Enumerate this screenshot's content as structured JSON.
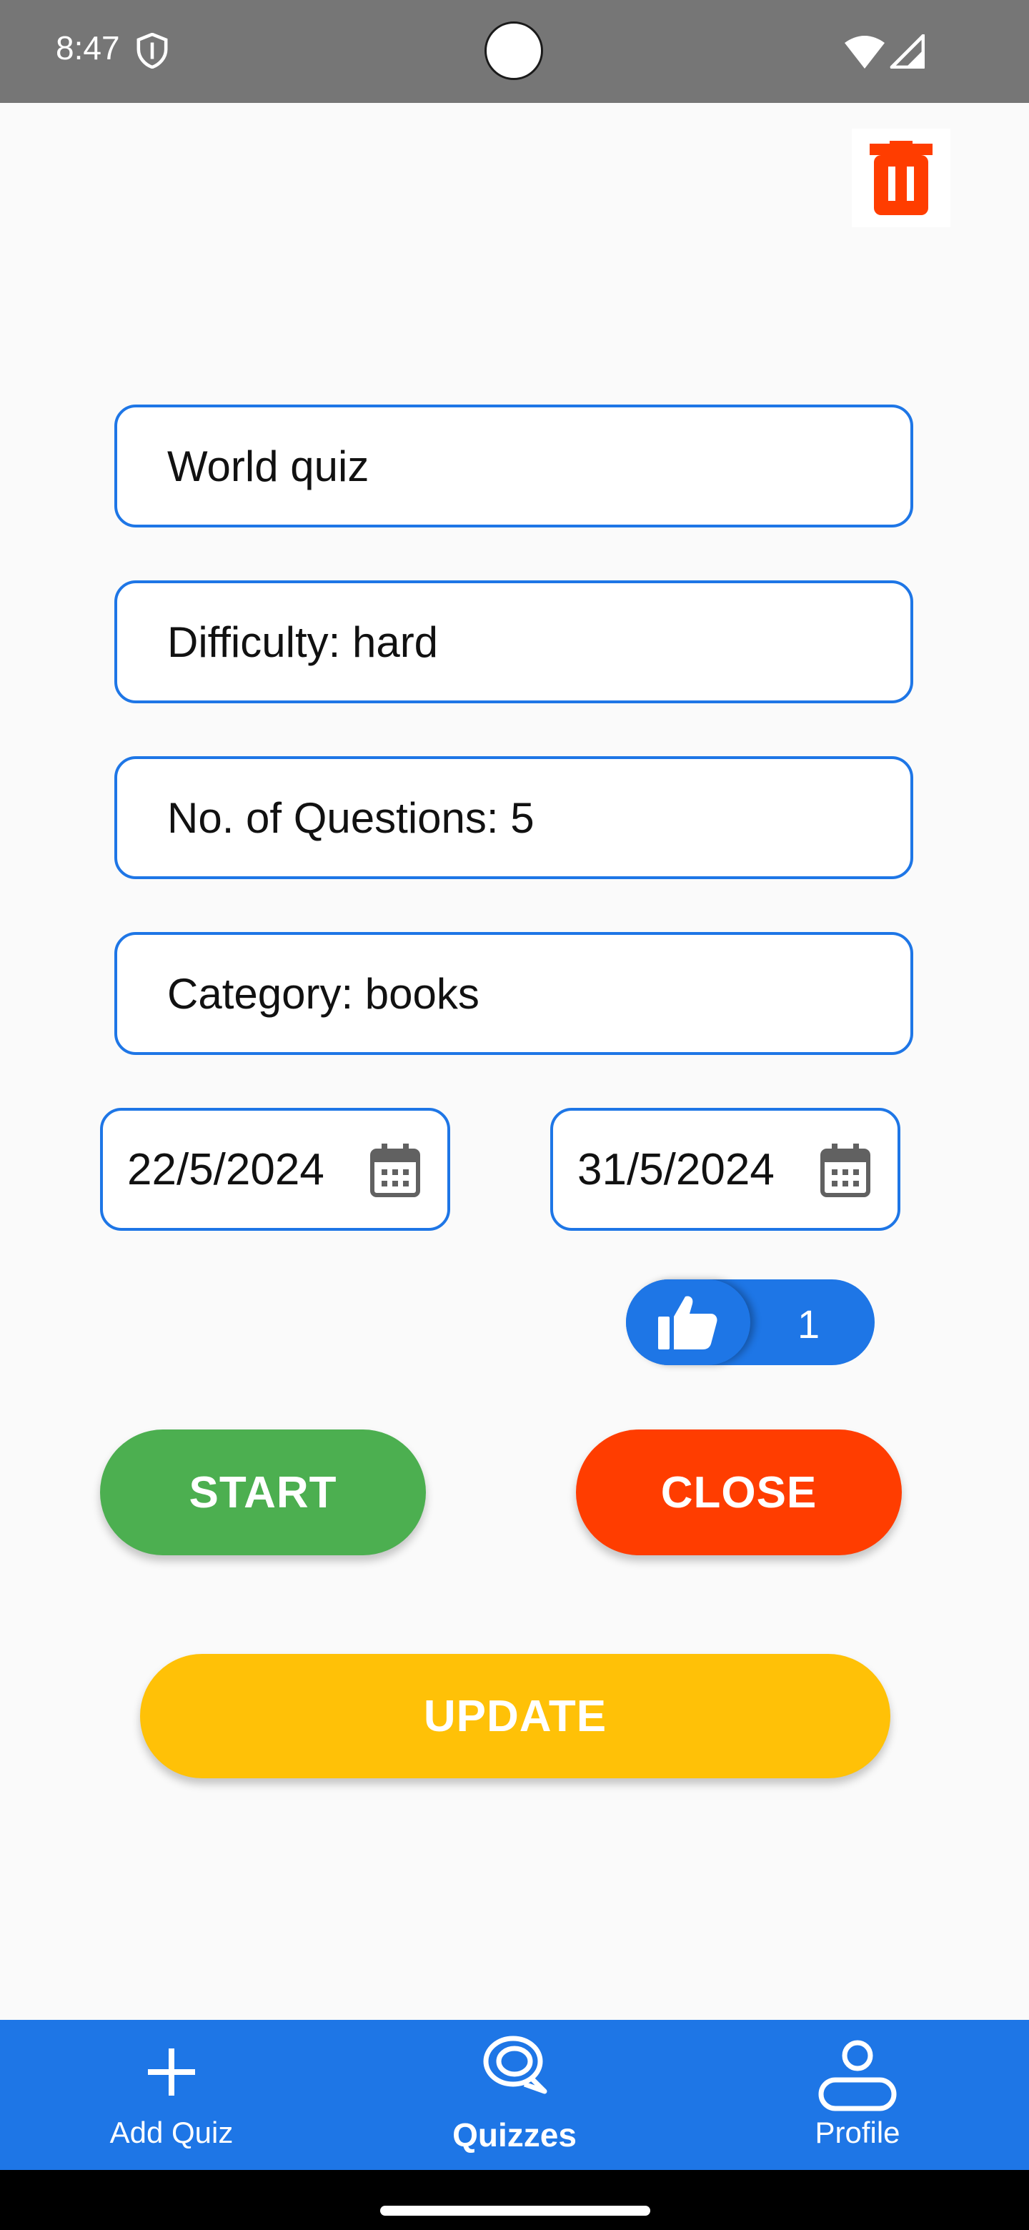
{
  "status_bar": {
    "time": "8:47"
  },
  "quiz": {
    "title": "World quiz",
    "difficulty": "Difficulty: hard",
    "questions": "No. of Questions: 5",
    "category": "Category: books",
    "start_date": "22/5/2024",
    "end_date": "31/5/2024"
  },
  "likes": {
    "count": "1"
  },
  "actions": {
    "start_label": "START",
    "close_label": "CLOSE",
    "update_label": "UPDATE"
  },
  "bottom_nav": {
    "items": [
      {
        "label": "Add Quiz",
        "icon": "plus-icon"
      },
      {
        "label": "Quizzes",
        "icon": "chat-bubble-icon",
        "active": true
      },
      {
        "label": "Profile",
        "icon": "person-icon"
      }
    ]
  },
  "colors": {
    "accent": "#1e76e6",
    "start": "#4caf50",
    "close": "#ff3d00",
    "update": "#ffc107",
    "delete": "#ff3d00",
    "status_bar": "#767676"
  }
}
